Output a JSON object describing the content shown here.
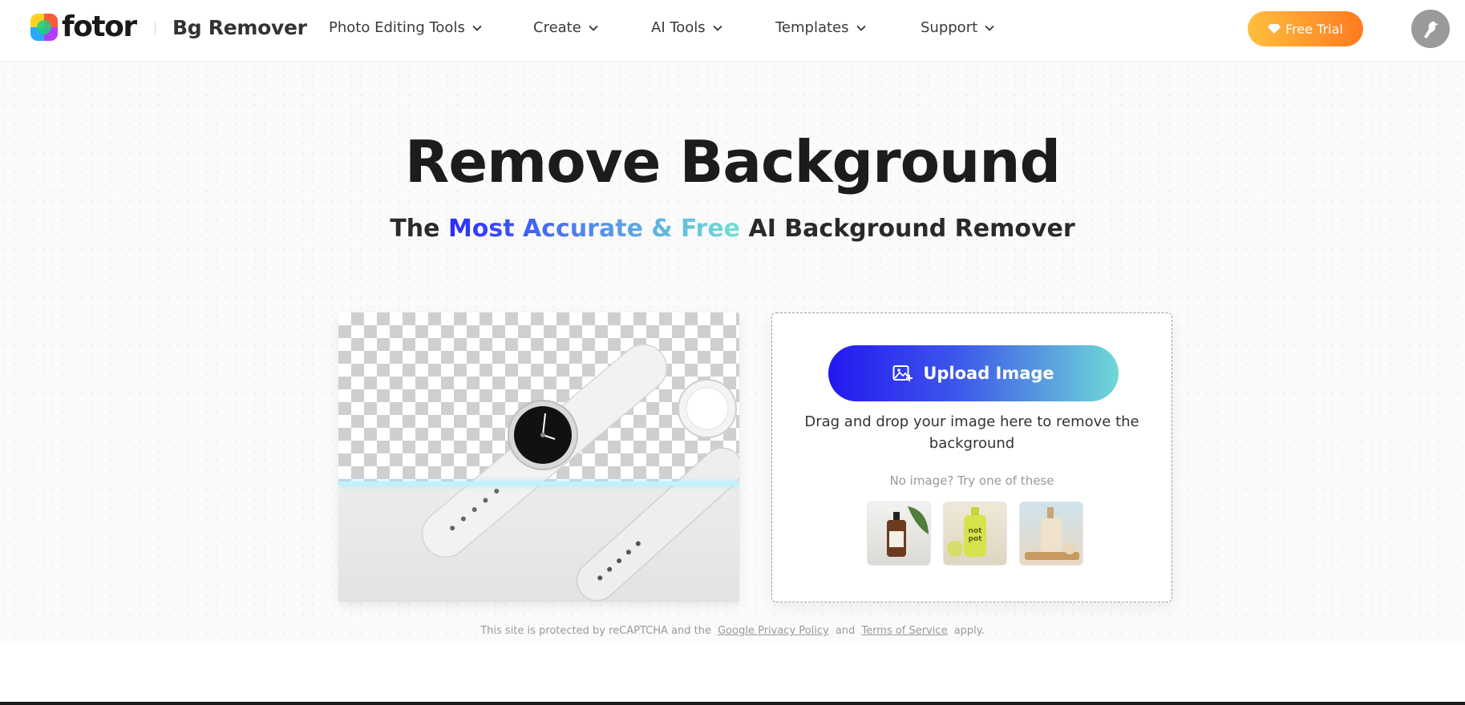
{
  "header": {
    "logo_text": "fotor",
    "product_name": "Bg Remover",
    "nav": [
      {
        "label": "Photo Editing Tools"
      },
      {
        "label": "Create"
      },
      {
        "label": "AI Tools"
      },
      {
        "label": "Templates"
      },
      {
        "label": "Support"
      }
    ],
    "free_trial_label": "Free Trial"
  },
  "hero": {
    "title": "Remove Background",
    "subtitle_prefix": "The ",
    "subtitle_highlight": "Most Accurate & Free",
    "subtitle_suffix": " AI Background Remover"
  },
  "upload": {
    "button_label": "Upload Image",
    "drop_text": "Drag and drop your image here to remove the background",
    "try_text": "No image?  Try one of these"
  },
  "footer": {
    "recaptcha_prefix": "This site is protected by reCAPTCHA and the",
    "privacy_link": "Google Privacy Policy",
    "and_text": "and",
    "terms_link": "Terms of Service",
    "recaptcha_suffix": "apply."
  },
  "colors": {
    "accent_start": "#2418f0",
    "accent_end": "#6fd8d6",
    "trial_start": "#ffbf3d",
    "trial_end": "#ff7a1f"
  },
  "icons": [
    "fotor-logo-icon",
    "chevron-down-icon",
    "diamond-icon",
    "bird-avatar-icon",
    "image-add-icon"
  ]
}
